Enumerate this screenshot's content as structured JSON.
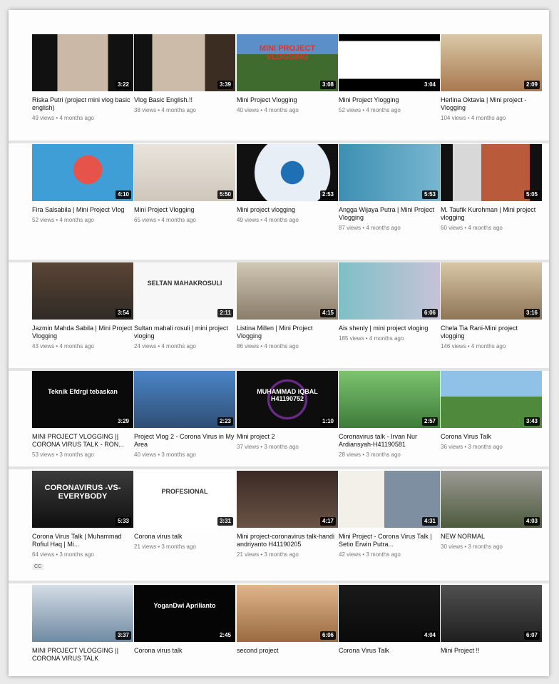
{
  "videos": [
    {
      "title": "Riska Putri (project mini vlog basic english)",
      "meta": "49 views • 4 months ago",
      "duration": "3:22"
    },
    {
      "title": "Vlog Basic English.!!",
      "meta": "38 views • 4 months ago",
      "duration": "3:39"
    },
    {
      "title": "Mini Project Vlogging",
      "meta": "40 views • 4 months ago",
      "duration": "3:08",
      "overlay": "MINI PROJECT VLOGGING"
    },
    {
      "title": "Mini Project Ylogging",
      "meta": "52 views • 4 months ago",
      "duration": "3:04"
    },
    {
      "title": "Herlina Oktavia | Mini project - Vlogging",
      "meta": "104 views • 4 months ago",
      "duration": "2:09"
    },
    {
      "title": "Fira Salsabila | Mini Project Vlog",
      "meta": "52 views • 4 months ago",
      "duration": "4:10"
    },
    {
      "title": "Mini Project Vlogging",
      "meta": "65 views • 4 months ago",
      "duration": "5:50"
    },
    {
      "title": "Mini project vlogging",
      "meta": "49 views • 4 months ago",
      "duration": "2:53"
    },
    {
      "title": "Angga Wijaya Putra | Mini Project Vlogging",
      "meta": "87 views • 4 months ago",
      "duration": "5:53"
    },
    {
      "title": "M. Taufik Kurohman | Mini project vlogging",
      "meta": "60 views • 4 months ago",
      "duration": "5:05"
    },
    {
      "title": "Jazmin Mahda Sabila | Mini Project Vlogging",
      "meta": "43 views • 4 months ago",
      "duration": "3:54"
    },
    {
      "title": "Sultan mahali rosuli | mini project vloging",
      "meta": "24 views • 4 months ago",
      "duration": "2:11",
      "overlay": "SELTAN MAHAKROSULI"
    },
    {
      "title": "Listina Millen | Mini Project Vlogging",
      "meta": "86 views • 4 months ago",
      "duration": "4:15"
    },
    {
      "title": "Ais shenly | mini project vloging",
      "meta": "185 views • 4 months ago",
      "duration": "6:06"
    },
    {
      "title": "Chela Tia Rani-Mini project vlogging",
      "meta": "146 views • 4 months ago",
      "duration": "3:16"
    },
    {
      "title": "MINI PROJECT VLOGGING || CORONA VIRUS TALK - RON...",
      "meta": "53 views • 3 months ago",
      "duration": "3:29",
      "overlay": "Teknik Efdrgi tebaskan"
    },
    {
      "title": "Project Vlog 2 - Corona Virus in My Area",
      "meta": "40 views • 3 months ago",
      "duration": "2:23"
    },
    {
      "title": "Mini project 2",
      "meta": "37 views • 3 months ago",
      "duration": "1:10",
      "overlay": "MUHAMMAD IQBAL H41190752"
    },
    {
      "title": "Coronavirus talk - Irvan Nur Ardiansyah-H41190581",
      "meta": "28 views • 3 months ago",
      "duration": "2:57"
    },
    {
      "title": "Corona Virus Talk",
      "meta": "36 views • 3 months ago",
      "duration": "3:43"
    },
    {
      "title": "Corona Virus Talk | Muhammad Rofiul Haq | Mi...",
      "meta": "64 views • 3 months ago",
      "duration": "5:33",
      "overlay": "CORONAVIRUS -VS- EVERYBODY",
      "badge": "CC"
    },
    {
      "title": "Corona virus talk",
      "meta": "21 views • 3 months ago",
      "duration": "3:31",
      "overlay": "PROFESIONAL"
    },
    {
      "title": "Mini project-coronavirus talk-handi andriyanto H41190205",
      "meta": "21 views • 3 months ago",
      "duration": "4:17"
    },
    {
      "title": "Mini Project - Corona Virus Talk | Setio Erwin Putra...",
      "meta": "42 views • 3 months ago",
      "duration": "4:31"
    },
    {
      "title": "NEW NORMAL",
      "meta": "30 views • 3 months ago",
      "duration": "4:03"
    },
    {
      "title": "MINI PROJECT VLOGGING || CORONA VIRUS TALK",
      "meta": "",
      "duration": "3:37"
    },
    {
      "title": "Corona virus talk",
      "meta": "",
      "duration": "2:45",
      "overlay": "YoganDwi Aprilianto"
    },
    {
      "title": "second project",
      "meta": "",
      "duration": "6:06"
    },
    {
      "title": "Corona Virus Talk",
      "meta": "",
      "duration": "4:04"
    },
    {
      "title": "Mini Project !!",
      "meta": "",
      "duration": "6:07"
    }
  ]
}
